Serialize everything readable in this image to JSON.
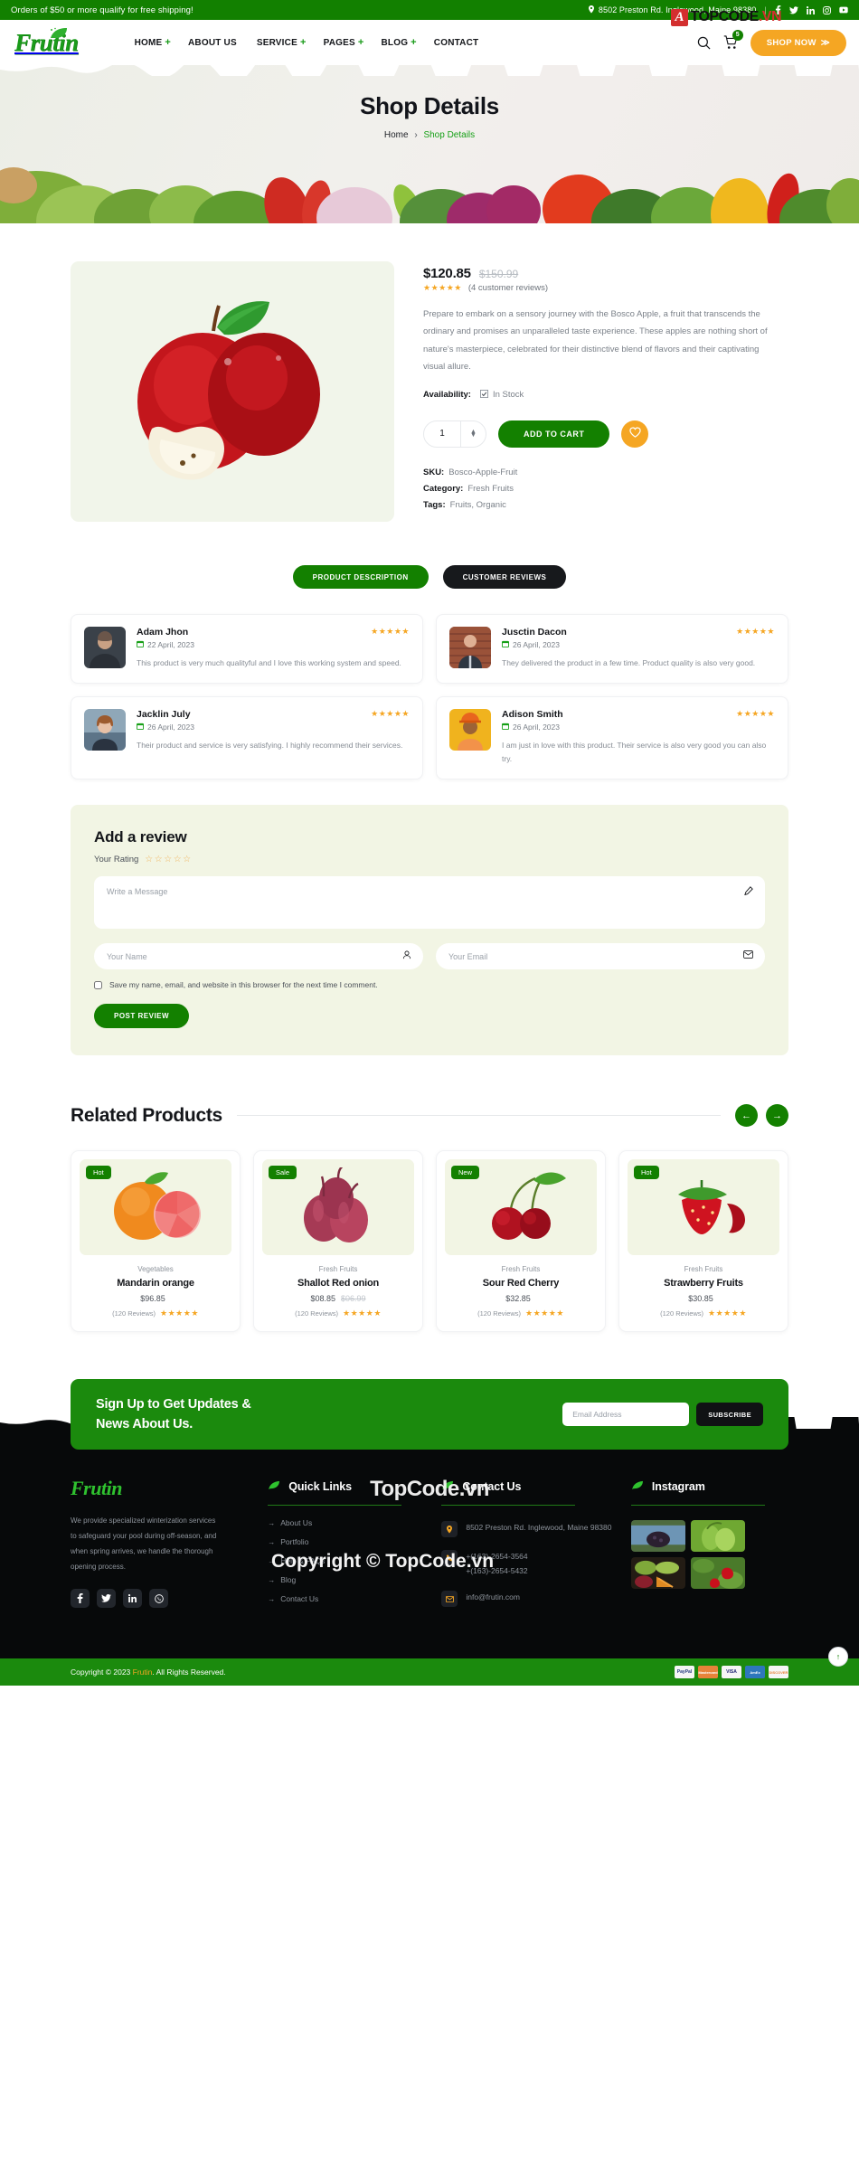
{
  "topbar": {
    "promo": "Orders of $50 or more qualify for free shipping!",
    "address": "8502 Preston Rd. Inglewood, Maine 98380",
    "socials": [
      "facebook-icon",
      "twitter-icon",
      "linkedin-icon",
      "instagram-icon",
      "youtube-icon"
    ]
  },
  "header": {
    "logo": "Frutin",
    "nav": [
      {
        "label": "HOME",
        "plus": "+"
      },
      {
        "label": "ABOUT US",
        "plus": ""
      },
      {
        "label": "SERVICE",
        "plus": "+"
      },
      {
        "label": "PAGES",
        "plus": "+"
      },
      {
        "label": "BLOG",
        "plus": "+"
      },
      {
        "label": "CONTACT",
        "plus": ""
      }
    ],
    "cart_count": "5",
    "shop_now": "SHOP NOW",
    "shop_now_arrow": "≫"
  },
  "banner": {
    "title": "Shop Details",
    "crumb_home": "Home",
    "crumb_sep": "›",
    "crumb_current": "Shop Details"
  },
  "product": {
    "price_now": "$120.85",
    "price_old": "$150.99",
    "stars": "★★★★★",
    "reviews_label": "(4 customer reviews)",
    "description": "Prepare to embark on a sensory journey with the Bosco Apple, a fruit that transcends the ordinary and promises an unparalleled taste experience. These apples are nothing short of nature's masterpiece, celebrated for their distinctive blend of flavors and their captivating visual allure.",
    "availability_label": "Availability:",
    "availability_value": "In Stock",
    "quantity": "1",
    "add_to_cart": "ADD TO CART",
    "wishlist_icon": "heart-icon",
    "sku_label": "SKU:",
    "sku_value": "Bosco-Apple-Fruit",
    "category_label": "Category:",
    "category_value": "Fresh Fruits",
    "tags_label": "Tags:",
    "tags_value": "Fruits, Organic"
  },
  "tabs": {
    "description": "PRODUCT DESCRIPTION",
    "reviews": "CUSTOMER REVIEWS"
  },
  "reviews": [
    {
      "name": "Adam Jhon",
      "date": "22 April, 2023",
      "stars": "★★★★★",
      "text": "This product is very much qualityful and I love this working system and speed."
    },
    {
      "name": "Jusctin Dacon",
      "date": "26 April, 2023",
      "stars": "★★★★★",
      "text": "They delivered the product in a few time. Product quality is also very good."
    },
    {
      "name": "Jacklin July",
      "date": "26 April, 2023",
      "stars": "★★★★★",
      "text": "Their product and service is very satisfying. I highly recommend their services."
    },
    {
      "name": "Adison Smith",
      "date": "26 April, 2023",
      "stars": "★★★★★",
      "text": "I am just in love with this product. Their service is also very good you can also try."
    }
  ],
  "add_review": {
    "title": "Add a review",
    "rating_label": "Your Rating",
    "rating_stars": "☆☆☆☆☆",
    "message_placeholder": "Write a Message",
    "name_placeholder": "Your Name",
    "email_placeholder": "Your Email",
    "save_label": "Save my name, email, and website in this browser for the next time I comment.",
    "submit": "POST REVIEW"
  },
  "related": {
    "title": "Related Products",
    "prev_icon": "arrow-left-icon",
    "next_icon": "arrow-right-icon",
    "products": [
      {
        "badge": "Hot",
        "category": "Vegetables",
        "name": "Mandarin orange",
        "price": "$96.85",
        "price_old": "",
        "reviews": "(120 Reviews)",
        "stars": "★★★★★"
      },
      {
        "badge": "Sale",
        "category": "Fresh Fruits",
        "name": "Shallot Red onion",
        "price": "$08.85",
        "price_old": "$06.99",
        "reviews": "(120 Reviews)",
        "stars": "★★★★★"
      },
      {
        "badge": "New",
        "category": "Fresh Fruits",
        "name": "Sour Red Cherry",
        "price": "$32.85",
        "price_old": "",
        "reviews": "(120 Reviews)",
        "stars": "★★★★★"
      },
      {
        "badge": "Hot",
        "category": "Fresh Fruits",
        "name": "Strawberry Fruits",
        "price": "$30.85",
        "price_old": "",
        "reviews": "(120 Reviews)",
        "stars": "★★★★★"
      }
    ]
  },
  "newsletter": {
    "title_line1": "Sign Up to Get Updates &",
    "title_line2": "News About Us.",
    "placeholder": "Email Address",
    "button": "SUBSCRIBE"
  },
  "footer": {
    "logo": "Frutin",
    "about": "We provide specialized winterization services to safeguard your pool during off-season, and when spring arrives, we handle the thorough opening process.",
    "socials": [
      "facebook-icon",
      "twitter-icon",
      "linkedin-icon",
      "whatsapp-icon"
    ],
    "quick_links_title": "Quick Links",
    "quick_links": [
      "About Us",
      "Portfolio",
      "Help & FAQs",
      "Blog",
      "Contact Us"
    ],
    "contact_title": "Contact Us",
    "contact_address": "8502 Preston Rd. Inglewood, Maine 98380",
    "contact_phone1": "+(163)-2654-3564",
    "contact_phone2": "+(163)-2654-5432",
    "contact_email": "info@frutin.com",
    "instagram_title": "Instagram",
    "copyright_pre": "Copyright © 2023 ",
    "copyright_brand": "Frutin",
    "copyright_post": ". All Rights Reserved.",
    "payments": [
      "PayPal",
      "Mastercard",
      "VISA",
      "AmEx",
      "DISCOVER"
    ],
    "to_top_icon": "arrow-up-icon"
  },
  "watermarks": {
    "topcode_badge": "A",
    "topcode_text": "TOPCODE",
    "topcode_vn": ".VN",
    "center": "TopCode.vn",
    "copyright": "Copyright © TopCode.vn"
  }
}
